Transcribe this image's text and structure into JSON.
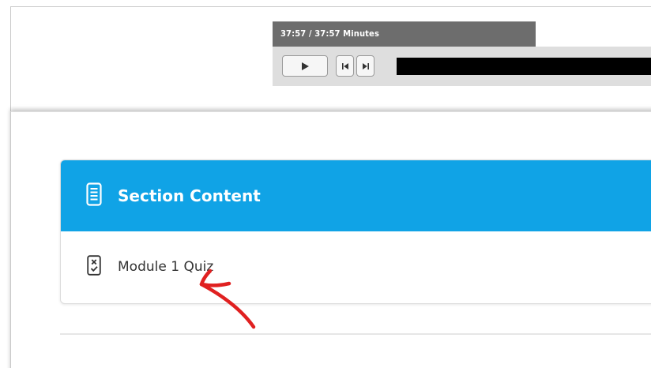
{
  "player": {
    "time_text": "37:57 / 37:57 Minutes",
    "buttons": [
      "play",
      "previous",
      "next"
    ]
  },
  "section": {
    "title": "Section Content",
    "header_color": "#10a3e6",
    "items": [
      {
        "label": "Module 1 Quiz",
        "icon": "quiz-icon"
      }
    ]
  },
  "icons": {
    "header": "document-list-icon",
    "item": "quiz-checklist-icon",
    "play": "play-icon",
    "previous": "skip-back-icon",
    "next": "skip-forward-icon"
  },
  "annotation": {
    "color": "#e02020",
    "kind": "arrow"
  }
}
